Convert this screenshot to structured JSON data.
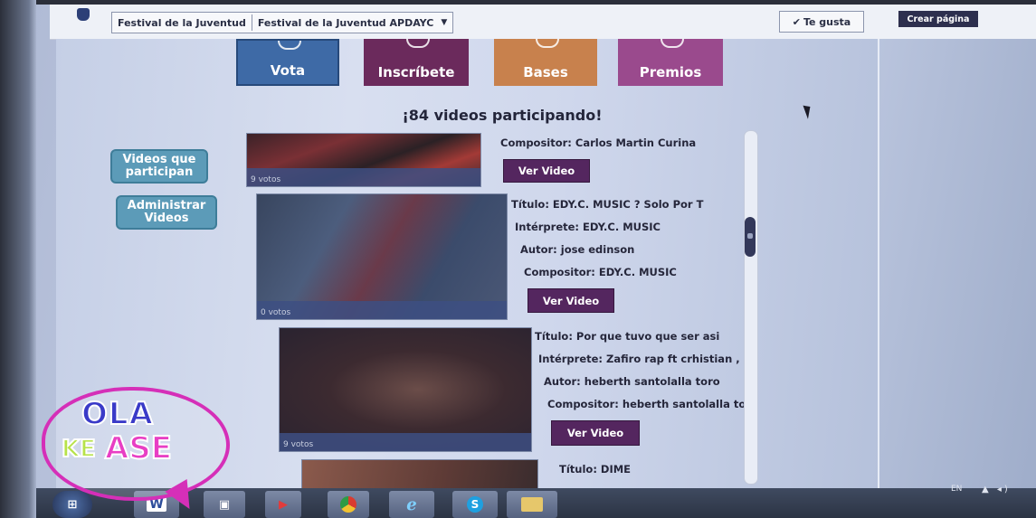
{
  "facebook_bar": {
    "breadcrumb_app": "Festival de la Juventud",
    "breadcrumb_page": "Festival de la Juventud APDAYC",
    "like_label": "Te gusta",
    "create_page_label": "Crear página"
  },
  "tabs": [
    {
      "label": "Vota"
    },
    {
      "label": "Inscríbete"
    },
    {
      "label": "Bases"
    },
    {
      "label": "Premios"
    }
  ],
  "heading": "¡84 videos participando!",
  "sidebar": {
    "videos_label": "Videos que participan",
    "admin_label": "Administrar Videos"
  },
  "videos": [
    {
      "votes": "9 votos",
      "composer": "Compositor: Carlos Martin Curina",
      "button": "Ver Video"
    },
    {
      "votes": "0 votos",
      "title": "Título: EDY.C. MUSIC  ? Solo Por T",
      "performer": "Intérprete: EDY.C. MUSIC",
      "author": "Autor: jose edinson",
      "composer": "Compositor: EDY.C. MUSIC",
      "button": "Ver Video"
    },
    {
      "votes": "9 votos",
      "title": "Título: Por que tuvo que ser asi",
      "performer": "Intérprete: Zafiro rap ft crhistian ,",
      "author": "Autor: heberth santolalla toro",
      "composer": "Compositor: heberth santolalla to",
      "button": "Ver Video"
    },
    {
      "title": "Título: DIME"
    }
  ],
  "taskbar": {
    "word_label": "W",
    "language": "EN"
  },
  "tv_logo": {
    "line1": "OLA",
    "line2a": "KE",
    "line2b": "ASE"
  },
  "colors": {
    "vota": "#3e6aa6",
    "inscribete": "#6b2a5c",
    "bases": "#c8814d",
    "premios": "#9a4a8d",
    "ver_video": "#54265f",
    "side_button": "#5c9bb8"
  }
}
